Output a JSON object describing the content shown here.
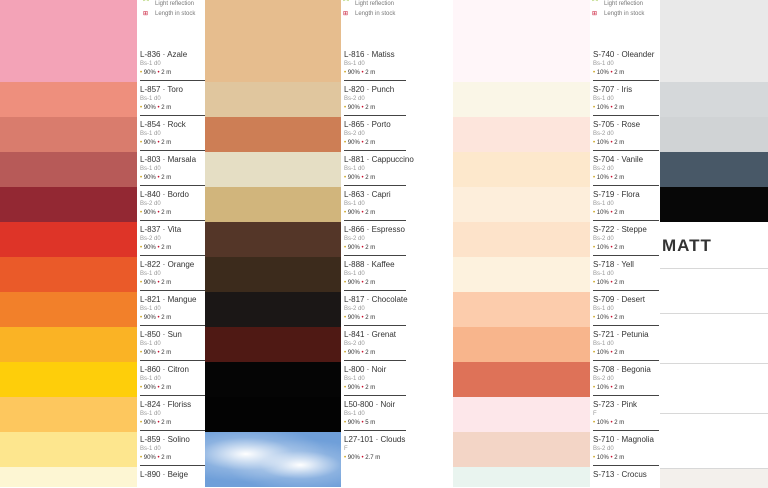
{
  "legend": {
    "light_reflection": "Light reflection",
    "length_in_stock": "Length in stock"
  },
  "section_title": "MATT",
  "columns": [
    [
      {
        "name": "L-836 · Azale",
        "fire": "Bs-1 d0",
        "reflect": "90%",
        "length": "2 m",
        "color": "#f3a3b7"
      },
      {
        "name": "L-857 · Toro",
        "fire": "Bs-1 d0",
        "reflect": "90%",
        "length": "2 m",
        "color": "#ee8f7d"
      },
      {
        "name": "L-854 · Rock",
        "fire": "Bs-1 d0",
        "reflect": "90%",
        "length": "2 m",
        "color": "#d97c6d"
      },
      {
        "name": "L-803 · Marsala",
        "fire": "Bs-1 d0",
        "reflect": "90%",
        "length": "2 m",
        "color": "#b75a58"
      },
      {
        "name": "L-840 · Bordo",
        "fire": "Bs-2 d0",
        "reflect": "90%",
        "length": "2 m",
        "color": "#932833"
      },
      {
        "name": "L-837 · Vita",
        "fire": "Bs-2 d0",
        "reflect": "90%",
        "length": "2 m",
        "color": "#de3428"
      },
      {
        "name": "L-822 · Orange",
        "fire": "Bs-1 d0",
        "reflect": "90%",
        "length": "2 m",
        "color": "#ea5a29"
      },
      {
        "name": "L-821 · Mangue",
        "fire": "Bs-1 d0",
        "reflect": "90%",
        "length": "2 m",
        "color": "#f2802a"
      },
      {
        "name": "L-850 · Sun",
        "fire": "Bs-1 d0",
        "reflect": "90%",
        "length": "2 m",
        "color": "#fab325"
      },
      {
        "name": "L-860 · Citron",
        "fire": "Bs-1 d0",
        "reflect": "90%",
        "length": "2 m",
        "color": "#fece0a"
      },
      {
        "name": "L-824 · Floriss",
        "fire": "Bs-1 d0",
        "reflect": "90%",
        "length": "2 m",
        "color": "#fdc75e"
      },
      {
        "name": "L-859 · Solino",
        "fire": "Bs-1 d0",
        "reflect": "90%",
        "length": "2 m",
        "color": "#fde68e"
      },
      {
        "name": "L-890 · Beige",
        "fire": "",
        "reflect": "",
        "length": "",
        "color": "#fdf6d3"
      }
    ],
    [
      {
        "name": "L-816 · Matiss",
        "fire": "Bs-1 d0",
        "reflect": "90%",
        "length": "2 m",
        "color": "#e6bd8e"
      },
      {
        "name": "L-820 · Punch",
        "fire": "Bs-2 d0",
        "reflect": "90%",
        "length": "2 m",
        "color": "#e0c69e"
      },
      {
        "name": "L-865 · Porto",
        "fire": "Bs-2 d0",
        "reflect": "90%",
        "length": "2 m",
        "color": "#cd7e55"
      },
      {
        "name": "L-881 · Cappuccino",
        "fire": "Bs-1 d0",
        "reflect": "90%",
        "length": "2 m",
        "color": "#e5dec4"
      },
      {
        "name": "L-863 · Capri",
        "fire": "Bs-1 d0",
        "reflect": "90%",
        "length": "2 m",
        "color": "#d1b57c"
      },
      {
        "name": "L-866 · Espresso",
        "fire": "Bs-2 d0",
        "reflect": "90%",
        "length": "2 m",
        "color": "#543628"
      },
      {
        "name": "L-888 · Kaffee",
        "fire": "Bs-1 d0",
        "reflect": "90%",
        "length": "2 m",
        "color": "#3c2b1c"
      },
      {
        "name": "L-817 · Chocolate",
        "fire": "Bs-2 d0",
        "reflect": "90%",
        "length": "2 m",
        "color": "#1b1716"
      },
      {
        "name": "L-841 · Grenat",
        "fire": "Bs-2 d0",
        "reflect": "90%",
        "length": "2 m",
        "color": "#4f1914"
      },
      {
        "name": "L-800 · Noir",
        "fire": "Bs-1 d0",
        "reflect": "90%",
        "length": "2 m",
        "color": "#050505"
      },
      {
        "name": "L50-800 · Noir",
        "fire": "Bs-1 d0",
        "reflect": "90%",
        "length": "5 m",
        "color": "#030303"
      },
      {
        "name": "L27-101 · Clouds",
        "fire": "F",
        "reflect": "90%",
        "length": "2.7 m",
        "color": "#6f9fd9"
      }
    ],
    [
      {
        "name": "S-740 · Oleander",
        "fire": "Bs-1 d0",
        "reflect": "10%",
        "length": "2 m",
        "color": "#fff6f9"
      },
      {
        "name": "S-707 · Iris",
        "fire": "Bs-1 d0",
        "reflect": "10%",
        "length": "2 m",
        "color": "#faf6e7"
      },
      {
        "name": "S-705 · Rose",
        "fire": "Bs-2 d0",
        "reflect": "10%",
        "length": "2 m",
        "color": "#fde5dc"
      },
      {
        "name": "S-704 · Vanile",
        "fire": "Bs-2 d0",
        "reflect": "10%",
        "length": "2 m",
        "color": "#fde8cc"
      },
      {
        "name": "S-719 · Flora",
        "fire": "Bs-1 d0",
        "reflect": "10%",
        "length": "2 m",
        "color": "#fdeedb"
      },
      {
        "name": "S-722 · Steppe",
        "fire": "Bs-2 d0",
        "reflect": "10%",
        "length": "2 m",
        "color": "#fde3ca"
      },
      {
        "name": "S-718 · Yell",
        "fire": "Bs-1 d0",
        "reflect": "10%",
        "length": "2 m",
        "color": "#fdf2de"
      },
      {
        "name": "S-709 · Desert",
        "fire": "Bs-1 d0",
        "reflect": "10%",
        "length": "2 m",
        "color": "#fcccac"
      },
      {
        "name": "S-721 · Petunia",
        "fire": "Bs-1 d0",
        "reflect": "10%",
        "length": "2 m",
        "color": "#f8b58c"
      },
      {
        "name": "S-708 · Begonia",
        "fire": "Bs-2 d0",
        "reflect": "10%",
        "length": "2 m",
        "color": "#de7258"
      },
      {
        "name": "S-723 · Pink",
        "fire": "F",
        "reflect": "10%",
        "length": "2 m",
        "color": "#fde7ea"
      },
      {
        "name": "S-710 · Magnolia",
        "fire": "Bs-2 d0",
        "reflect": "10%",
        "length": "2 m",
        "color": "#f3d5c6"
      },
      {
        "name": "S-713 · Crocus",
        "fire": "",
        "reflect": "",
        "length": "",
        "color": "#e9f4ef"
      }
    ]
  ],
  "right_swatches": [
    {
      "color": "#e9e9e9"
    },
    {
      "color": "#d5d8da"
    },
    {
      "color": "#d0d3d5"
    },
    {
      "color": "#485867"
    },
    {
      "color": "#070707"
    }
  ]
}
